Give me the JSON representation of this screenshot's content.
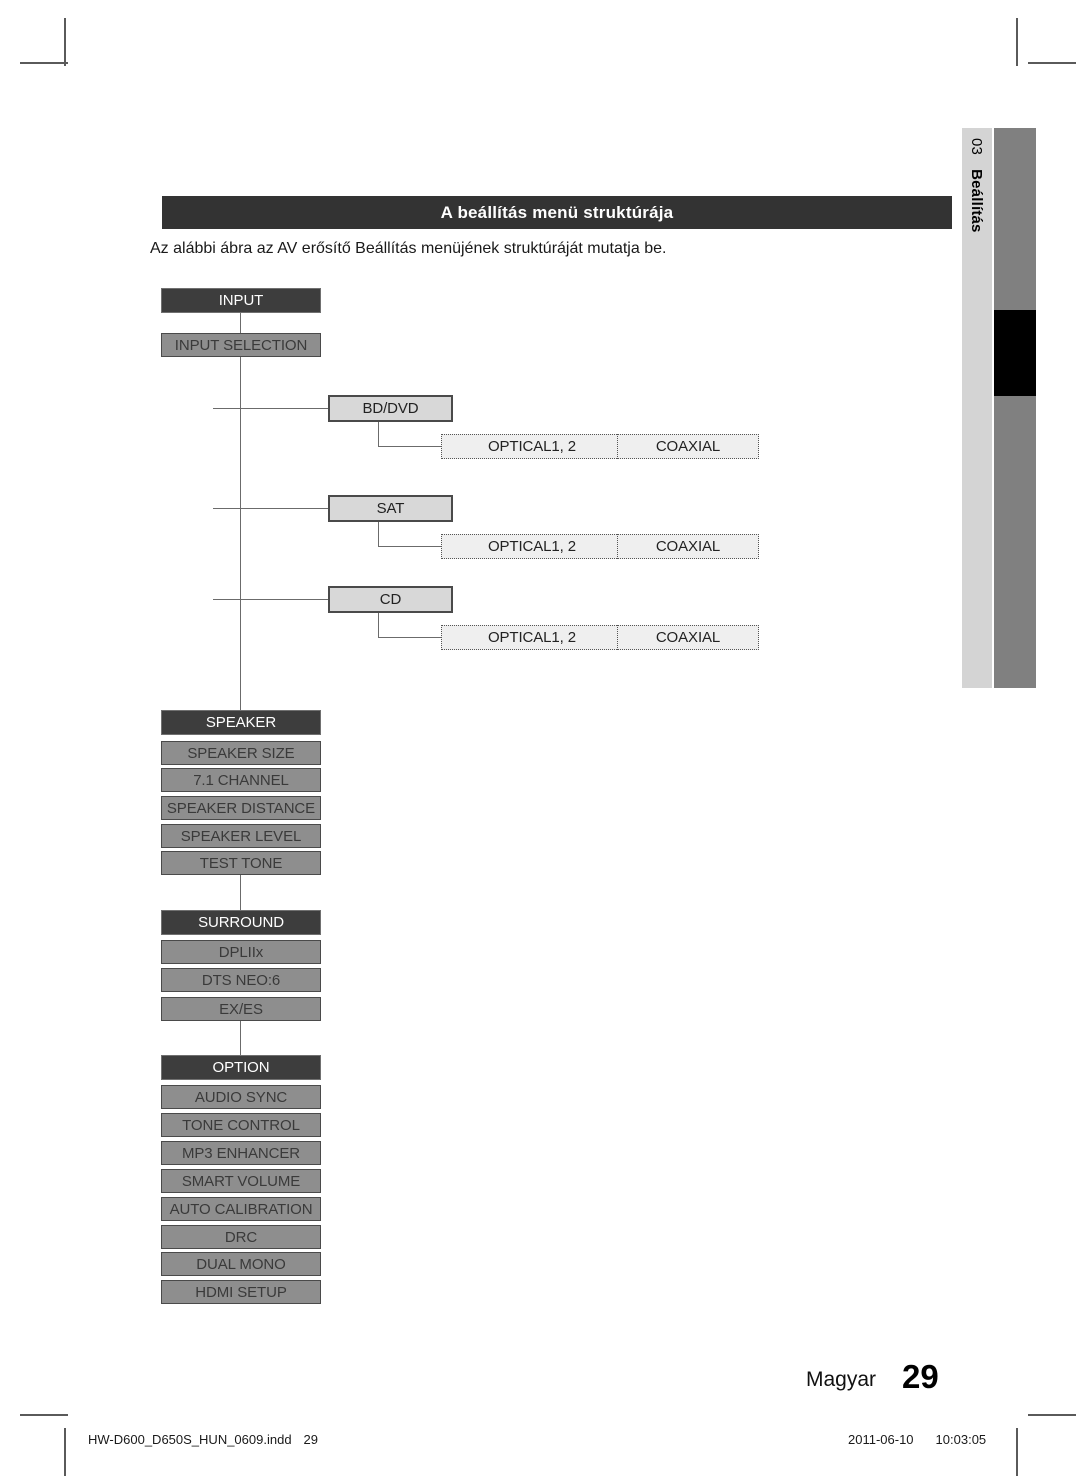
{
  "page": {
    "section_title": "A beállítás menü struktúrája",
    "intro": "Az alábbi ábra az AV erősítő Beállítás menüjének struktúráját mutatja be.",
    "language_label": "Magyar",
    "page_number": "29",
    "tab_number": "03",
    "tab_title": "Beállítás"
  },
  "footer": {
    "file_name": "HW-D600_D650S_HUN_0609.indd",
    "file_page": "29",
    "date": "2011-06-10",
    "time": "10:03:05"
  },
  "colors": {
    "title_bar": "#333333",
    "node_header": "#3d3d3d",
    "node_item": "#8e8e8e",
    "node_sub": "#d8d8d8",
    "node_leaf": "#efefef",
    "tab_light": "#d4d4d4",
    "tab_gray": "#808080",
    "tab_black": "#000000"
  },
  "chart_data": {
    "type": "diagram",
    "title": "A beállítás menü struktúrája",
    "groups": [
      {
        "header": "INPUT",
        "items": [
          "INPUT SELECTION"
        ],
        "branches": [
          {
            "label": "BD/DVD",
            "leaves": [
              "OPTICAL1, 2",
              "COAXIAL"
            ]
          },
          {
            "label": "SAT",
            "leaves": [
              "OPTICAL1, 2",
              "COAXIAL"
            ]
          },
          {
            "label": "CD",
            "leaves": [
              "OPTICAL1, 2",
              "COAXIAL"
            ]
          }
        ]
      },
      {
        "header": "SPEAKER",
        "items": [
          "SPEAKER SIZE",
          "7.1 CHANNEL",
          "SPEAKER DISTANCE",
          "SPEAKER LEVEL",
          "TEST TONE"
        ],
        "branches": []
      },
      {
        "header": "SURROUND",
        "items": [
          "DPLIIx",
          "DTS NEO:6",
          "EX/ES"
        ],
        "branches": []
      },
      {
        "header": "OPTION",
        "items": [
          "AUDIO SYNC",
          "TONE CONTROL",
          "MP3 ENHANCER",
          "SMART VOLUME",
          "AUTO CALIBRATION",
          "DRC",
          "DUAL MONO",
          "HDMI SETUP"
        ],
        "branches": []
      }
    ]
  },
  "nodes": {
    "input_header": "INPUT",
    "input_selection": "INPUT SELECTION",
    "bd_dvd": "BD/DVD",
    "bd_optical": "OPTICAL1, 2",
    "bd_coaxial": "COAXIAL",
    "sat": "SAT",
    "sat_optical": "OPTICAL1, 2",
    "sat_coaxial": "COAXIAL",
    "cd": "CD",
    "cd_optical": "OPTICAL1, 2",
    "cd_coaxial": "COAXIAL",
    "speaker_header": "SPEAKER",
    "speaker_size": "SPEAKER SIZE",
    "speaker_channel": "7.1 CHANNEL",
    "speaker_distance": "SPEAKER DISTANCE",
    "speaker_level": "SPEAKER LEVEL",
    "speaker_test_tone": "TEST TONE",
    "surround_header": "SURROUND",
    "surround_dpliix": "DPLIIx",
    "surround_dts": "DTS NEO:6",
    "surround_exes": "EX/ES",
    "option_header": "OPTION",
    "option_audio_sync": "AUDIO SYNC",
    "option_tone_control": "TONE CONTROL",
    "option_mp3": "MP3 ENHANCER",
    "option_smart_volume": "SMART VOLUME",
    "option_auto_cal": "AUTO CALIBRATION",
    "option_drc": "DRC",
    "option_dual_mono": "DUAL MONO",
    "option_hdmi": "HDMI SETUP"
  }
}
